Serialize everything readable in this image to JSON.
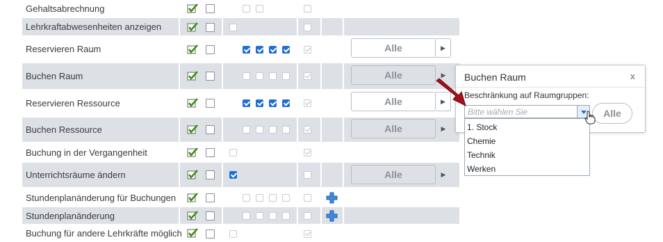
{
  "rows": [
    {
      "label": "Gehaltsabrechnung"
    },
    {
      "label": "Lehrkraftabwesenheiten anzeigen"
    },
    {
      "label": "Reservieren Raum",
      "button": "Alle"
    },
    {
      "label": "Buchen Raum",
      "button": "Alle"
    },
    {
      "label": "Reservieren Ressource",
      "button": "Alle"
    },
    {
      "label": "Buchen Ressource",
      "button": "Alle"
    },
    {
      "label": "Buchung in der Vergangenheit"
    },
    {
      "label": "Unterrichtsräume ändern",
      "button": "Alle"
    },
    {
      "label": "Stundenplanänderung für Buchungen"
    },
    {
      "label": "Stundenplanänderung"
    },
    {
      "label": "Buchung für andere Lehrkräfte möglich"
    }
  ],
  "popup": {
    "title": "Buchen Raum",
    "close": "x",
    "label": "Beschränkung auf Raumgruppen:",
    "placeholder": "Bitte wählen Sie",
    "button": "Alle",
    "options": [
      "1. Stock",
      "Chemie",
      "Technik",
      "Werken"
    ]
  },
  "colors": {
    "row_shade": "#dde1e6",
    "check_green": "#3c8f12",
    "accent_blue": "#1d6fd6",
    "pointer_red": "#a3101a"
  }
}
